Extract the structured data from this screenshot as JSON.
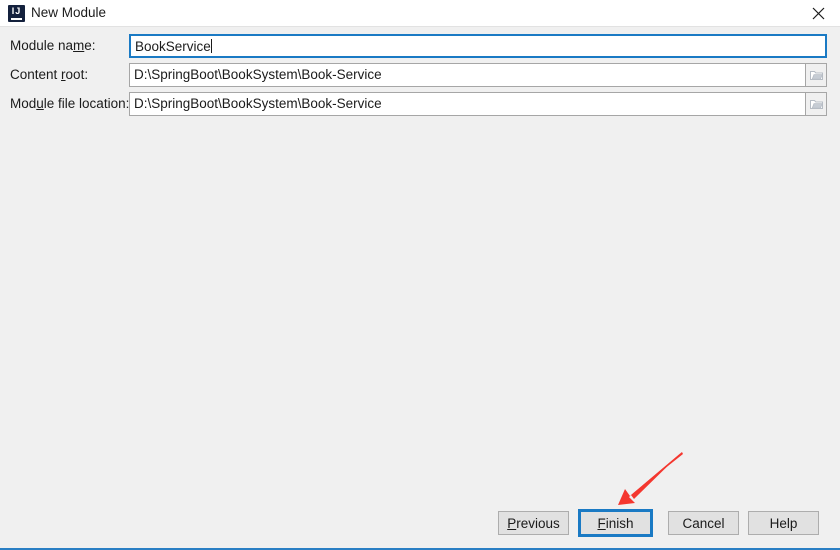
{
  "window": {
    "title": "New Module",
    "app_icon": "intellij-idea-icon",
    "icon_letters": "IJ",
    "close_icon": "close-icon",
    "border_color": "#2a7fc4"
  },
  "form": {
    "fields": [
      {
        "label_prefix": "Module na",
        "label_mnemonic": "m",
        "label_suffix": "e:",
        "value": "BookService",
        "placeholder": "",
        "focused": true,
        "has_browse": false,
        "browse_icon": "folder-icon"
      },
      {
        "label_prefix": "Content ",
        "label_mnemonic": "r",
        "label_suffix": "oot:",
        "value": "D:\\SpringBoot\\BookSystem\\Book-Service",
        "placeholder": "",
        "focused": false,
        "has_browse": true,
        "browse_icon": "folder-icon"
      },
      {
        "label_prefix": "Mod",
        "label_mnemonic": "u",
        "label_suffix": "le file location:",
        "value": "D:\\SpringBoot\\BookSystem\\Book-Service",
        "placeholder": "",
        "focused": false,
        "has_browse": true,
        "browse_icon": "folder-icon"
      }
    ]
  },
  "buttons": {
    "previous": {
      "prefix": "",
      "mnemonic": "P",
      "suffix": "revious"
    },
    "finish": {
      "prefix": "",
      "mnemonic": "F",
      "suffix": "inish",
      "focused": true
    },
    "cancel": {
      "prefix": "Cancel",
      "mnemonic": "",
      "suffix": ""
    },
    "help": {
      "prefix": "Help",
      "mnemonic": "",
      "suffix": ""
    }
  },
  "annotation": {
    "type": "arrow",
    "color": "#f4372f",
    "points_to": "finish-button"
  }
}
